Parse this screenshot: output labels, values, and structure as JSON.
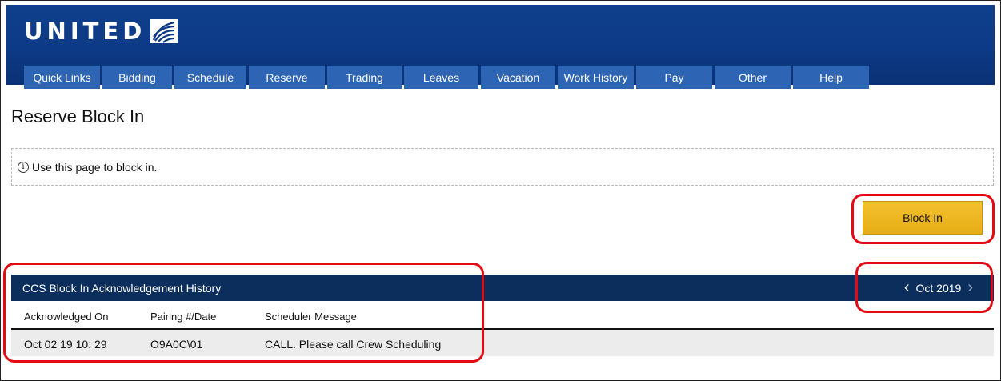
{
  "brand": {
    "logo_text": "UNITED"
  },
  "nav": {
    "items": [
      {
        "label": "Quick Links",
        "width": 95
      },
      {
        "label": "Bidding",
        "width": 87
      },
      {
        "label": "Schedule",
        "width": 90
      },
      {
        "label": "Reserve",
        "width": 95
      },
      {
        "label": "Trading",
        "width": 93
      },
      {
        "label": "Leaves",
        "width": 93
      },
      {
        "label": "Vacation",
        "width": 93
      },
      {
        "label": "Work History",
        "width": 95
      },
      {
        "label": "Pay",
        "width": 95
      },
      {
        "label": "Other",
        "width": 95
      },
      {
        "label": "Help",
        "width": 95
      }
    ]
  },
  "page": {
    "title": "Reserve Block In",
    "info_text": "Use this page to block in.",
    "block_in_label": "Block In"
  },
  "history": {
    "title": "CCS Block In Acknowledgement History",
    "month": "Oct 2019",
    "columns": [
      "Acknowledged On",
      "Pairing #/Date",
      "Scheduler Message"
    ],
    "rows": [
      [
        "Oct 02 19 10: 29",
        "O9A0C\\01",
        "CALL. Please call Crew Scheduling"
      ]
    ]
  },
  "colors": {
    "header_blue": "#0d3a85",
    "nav_tab": "#2d64b3",
    "table_bar": "#0b2e5c",
    "button_gold": "#e7ad16",
    "annotation_red": "#e50914"
  }
}
